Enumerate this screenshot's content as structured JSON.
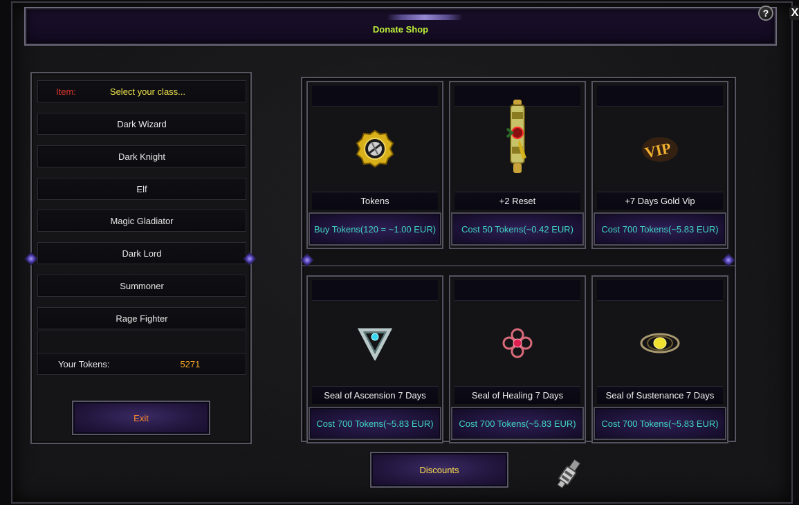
{
  "window": {
    "title": "Donate Shop",
    "help_label": "?",
    "close_label": "X"
  },
  "left_panel": {
    "item_label": "Item:",
    "item_value": "Select your class...",
    "classes": [
      "Dark Wizard",
      "Dark Knight",
      "Elf",
      "Magic Gladiator",
      "Dark Lord",
      "Summoner",
      "Rage Fighter"
    ],
    "tokens_label": "Your Tokens:",
    "tokens_value": "5271",
    "exit_label": "Exit"
  },
  "shop": {
    "items": [
      {
        "name": "Tokens",
        "cost": "Buy Tokens(120 = ~1.00 EUR)",
        "icon": "token-coin-icon"
      },
      {
        "name": "+2 Reset",
        "cost": "Cost 50 Tokens(~0.42 EUR)",
        "icon": "scroll-icon"
      },
      {
        "name": "+7 Days Gold Vip",
        "cost": "Cost 700 Tokens(~5.83 EUR)",
        "icon": "vip-badge-icon"
      },
      {
        "name": "Seal of Ascension 7 Days",
        "cost": "Cost 700 Tokens(~5.83 EUR)",
        "icon": "seal-ascension-icon"
      },
      {
        "name": "Seal of Healing 7 Days",
        "cost": "Cost 700 Tokens(~5.83 EUR)",
        "icon": "seal-healing-icon"
      },
      {
        "name": "Seal of Sustenance 7 Days",
        "cost": "Cost 700 Tokens(~5.83 EUR)",
        "icon": "seal-sustenance-icon"
      }
    ],
    "discounts_label": "Discounts"
  },
  "colors": {
    "title": "#bff23a",
    "item_label": "#e0362e",
    "item_value": "#f2e64a",
    "tokens_value": "#f5a623",
    "cost_text": "#3fd6c2",
    "exit_text": "#ff8a2a",
    "discounts_text": "#ffe34a"
  }
}
